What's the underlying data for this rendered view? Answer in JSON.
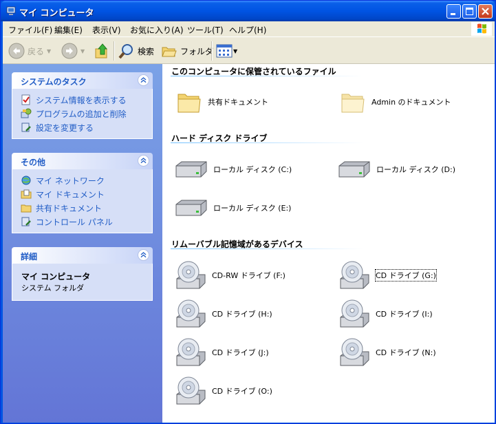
{
  "window": {
    "title": "マイ コンピュータ"
  },
  "menu": [
    "ファイル(F)",
    "編集(E)",
    "表示(V)",
    "お気に入り(A)",
    "ツール(T)",
    "ヘルプ(H)"
  ],
  "toolbar": {
    "back": "戻る",
    "search": "検索",
    "folders": "フォルダ"
  },
  "tasks": {
    "title": "システムのタスク",
    "links": [
      "システム情報を表示する",
      "プログラムの追加と削除",
      "設定を変更する"
    ]
  },
  "other": {
    "title": "その他",
    "links": [
      "マイ ネットワーク",
      "マイ ドキュメント",
      "共有ドキュメント",
      "コントロール パネル"
    ]
  },
  "details": {
    "title": "詳細",
    "name": "マイ コンピュータ",
    "subtitle": "システム フォルダ"
  },
  "groups": {
    "stored": {
      "title": "このコンピュータに保管されているファイル",
      "items": [
        "共有ドキュメント",
        "Admin のドキュメント"
      ]
    },
    "hdd": {
      "title": "ハード ディスク ドライブ",
      "items": [
        "ローカル ディスク (C:)",
        "ローカル ディスク (D:)",
        "ローカル ディスク (E:)"
      ]
    },
    "removable": {
      "title": "リムーバブル記憶域があるデバイス",
      "items": [
        "CD-RW ドライブ (F:)",
        "CD ドライブ (G:)",
        "CD ドライブ (H:)",
        "CD ドライブ (I:)",
        "CD ドライブ (J:)",
        "CD ドライブ (N:)",
        "CD ドライブ (O:)"
      ]
    }
  }
}
